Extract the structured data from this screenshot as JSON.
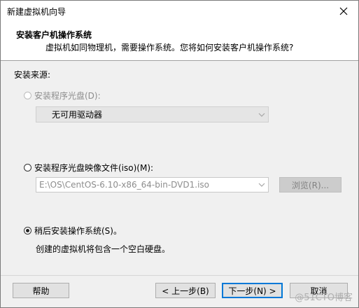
{
  "window": {
    "title": "新建虚拟机向导"
  },
  "header": {
    "title": "安装客户机操作系统",
    "subtitle": "虚拟机如同物理机，需要操作系统。您将如何安装客户机操作系统?"
  },
  "source": {
    "label": "安装来源:",
    "disc": {
      "label": "安装程序光盘(D):",
      "selected": false,
      "enabled": false,
      "dropdown_value": "无可用驱动器"
    },
    "iso": {
      "label": "安装程序光盘映像文件(iso)(M):",
      "selected": false,
      "enabled": true,
      "path_value": "E:\\OS\\CentOS-6.10-x86_64-bin-DVD1.iso",
      "browse_label": "浏览(R)..."
    },
    "later": {
      "label": "稍后安装操作系统(S)。",
      "selected": true,
      "description": "创建的虚拟机将包含一个空白硬盘。"
    }
  },
  "footer": {
    "help_label": "帮助",
    "back_label": "< 上一步(B)",
    "next_label": "下一步(N) >",
    "cancel_label": "取消"
  },
  "watermark": "@51CTO博客"
}
